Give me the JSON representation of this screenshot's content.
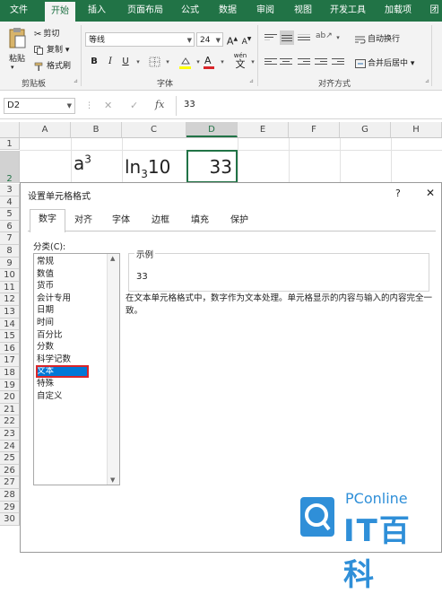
{
  "ribbon_tabs": [
    "文件",
    "开始",
    "插入",
    "页面布局",
    "公式",
    "数据",
    "审阅",
    "视图",
    "开发工具",
    "加载项",
    "团"
  ],
  "ribbon": {
    "clipboard": {
      "paste": "粘贴",
      "cut": "剪切",
      "copy": "复制",
      "format_painter": "格式刷",
      "label": "剪贴板"
    },
    "font": {
      "name": "等线",
      "size": "24",
      "bold": "B",
      "italic": "I",
      "underline": "U",
      "grow": "A",
      "shrink": "A",
      "wen": "wén",
      "wen_char": "文",
      "label": "字体"
    },
    "alignment": {
      "wrap": "自动换行",
      "merge": "合并后居中",
      "label": "对齐方式"
    }
  },
  "formula_bar": {
    "name_box": "D2",
    "cancel": "✕",
    "confirm": "✓",
    "fx": "fx",
    "value": "33"
  },
  "columns": [
    "A",
    "B",
    "C",
    "D",
    "E",
    "F",
    "G",
    "H"
  ],
  "rows": [
    "1",
    "2",
    "3",
    "4",
    "5",
    "6",
    "7",
    "8",
    "9",
    "10",
    "11",
    "12",
    "13",
    "14",
    "15",
    "16",
    "17",
    "18",
    "19",
    "20",
    "21",
    "22",
    "23",
    "24",
    "25",
    "26",
    "27",
    "28",
    "29",
    "30"
  ],
  "cells": {
    "b2_base": "a",
    "b2_sup": "3",
    "c2_pre": "ln",
    "c2_sub": "3",
    "c2_post": "10",
    "d2": "33"
  },
  "dialog": {
    "title": "设置单元格格式",
    "help": "?",
    "close": "✕",
    "tabs": [
      "数字",
      "对齐",
      "字体",
      "边框",
      "填充",
      "保护"
    ],
    "active_tab": "数字",
    "category_label": "分类(C):",
    "categories": [
      "常规",
      "数值",
      "货币",
      "会计专用",
      "日期",
      "时间",
      "百分比",
      "分数",
      "科学记数",
      "文本",
      "特殊",
      "自定义"
    ],
    "selected_category": "文本",
    "sample_label": "示例",
    "sample_value": "33",
    "description": "在文本单元格格式中，数字作为文本处理。单元格显示的内容与输入的内容完全一致。"
  },
  "watermark": {
    "brand": "PConline",
    "name": "IT百科"
  },
  "colors": {
    "excel_green": "#217346",
    "selection_blue": "#0078d7",
    "highlight_red": "#d9252a",
    "watermark": "#2f8fd8"
  }
}
